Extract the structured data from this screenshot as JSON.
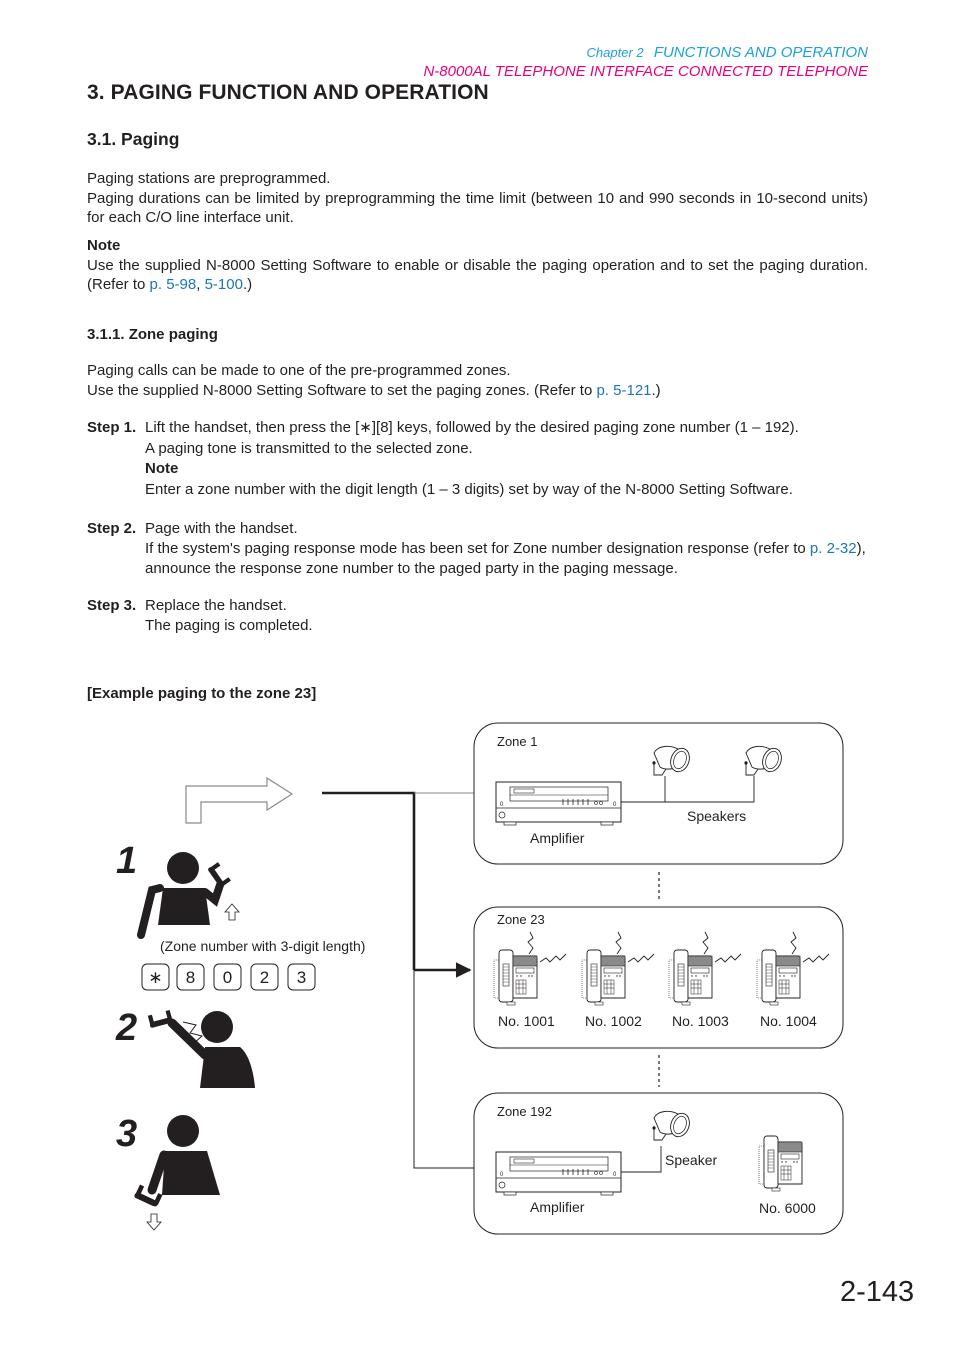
{
  "header": {
    "chapter_label": "Chapter 2",
    "chapter_title": "FUNCTIONS AND OPERATION",
    "subtitle": "N-8000AL TELEPHONE INTERFACE CONNECTED TELEPHONE",
    "colors": {
      "chapter": "#1ba1d8",
      "subtitle": "#e6007e",
      "link": "#1b75bb"
    }
  },
  "section": {
    "title": "3. PAGING FUNCTION AND OPERATION",
    "subsection_title": "3.1. Paging",
    "intro_line1": "Paging stations are preprogrammed.",
    "intro_line2": "Paging durations can be limited by preprogramming the time limit (between 10 and 990 seconds in 10-second units) for each C/O line interface unit.",
    "note_label": "Note",
    "note_text_before": "Use the supplied N-8000 Setting Software to enable or disable the paging operation and to set the paging duration. (Refer to ",
    "note_link1": "p. 5-98",
    "note_sep": ", ",
    "note_link2": "5-100",
    "note_text_after": ".)"
  },
  "zone_paging": {
    "title": "3.1.1. Zone paging",
    "line1": "Paging calls can be made to one of the pre-programmed zones.",
    "line2_before": "Use the supplied N-8000 Setting Software to set the paging zones. (Refer to ",
    "line2_link": "p. 5-121",
    "line2_after": ".)",
    "steps": [
      {
        "label": "Step 1.",
        "line1": "Lift the handset, then press the [∗][8] keys, followed by the desired paging zone number (1 – 192).",
        "line2": "A paging tone is transmitted to the selected zone.",
        "note_label": "Note",
        "note_text": "Enter a zone number with the digit length (1 – 3 digits) set by way of the N-8000 Setting Software."
      },
      {
        "label": "Step 2.",
        "line1": "Page with the handset.",
        "line2_before": "If the system's paging response mode has been set for Zone number designation response (refer to ",
        "line2_link": "p. 2-32",
        "line2_after": "), announce the response zone number to the paged party in the paging message."
      },
      {
        "label": "Step 3.",
        "line1": "Replace the handset.",
        "line2": "The paging is completed."
      }
    ]
  },
  "example": {
    "title": "[Example paging to the zone 23]",
    "step_numbers": [
      "1",
      "2",
      "3"
    ],
    "zone_number_caption": "(Zone number with 3-digit length)",
    "keys": [
      "∗",
      "8",
      "0",
      "2",
      "3"
    ],
    "zones": [
      {
        "name": "Zone 1",
        "amplifier_label": "Amplifier",
        "speakers_label": "Speakers"
      },
      {
        "name": "Zone 23",
        "phones": [
          "No. 1001",
          "No. 1002",
          "No. 1003",
          "No. 1004"
        ]
      },
      {
        "name": "Zone 192",
        "amplifier_label": "Amplifier",
        "speaker_label": "Speaker",
        "phone": "No. 6000"
      }
    ]
  },
  "footer": {
    "page_number": "2-143"
  }
}
